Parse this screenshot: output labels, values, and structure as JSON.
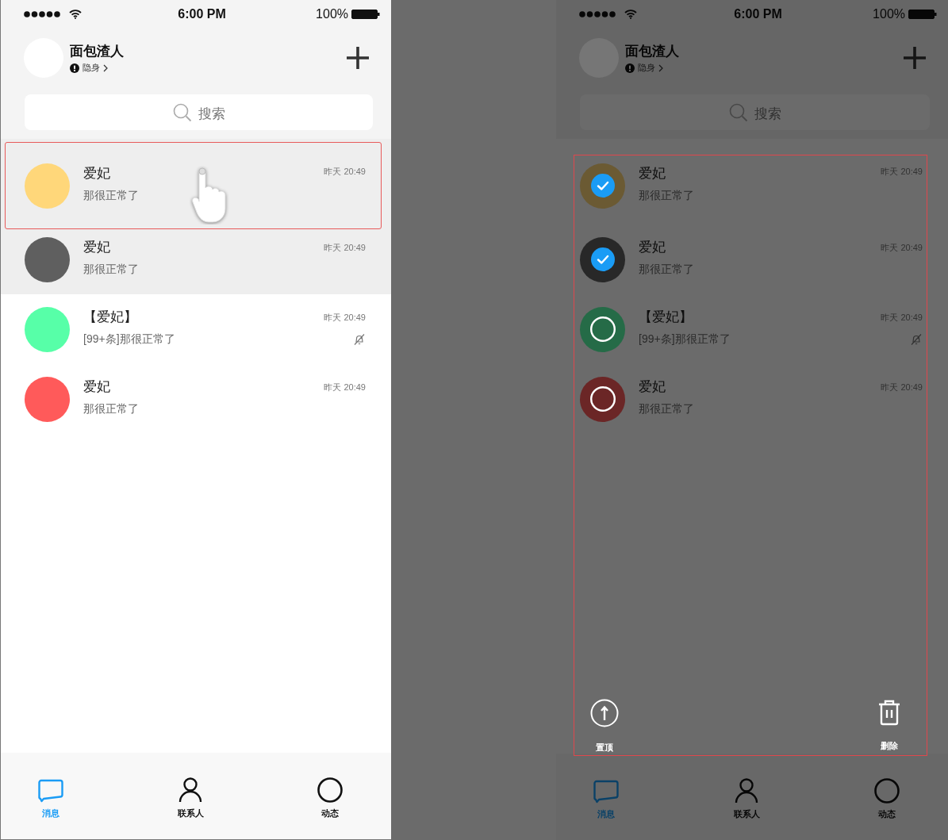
{
  "screens": [
    {
      "kind": "normal",
      "status_bar": {
        "time": "6:00 PM",
        "battery": "100%"
      },
      "profile": {
        "name": "面包渣人",
        "status": "隐身"
      },
      "search": {
        "placeholder": "搜索"
      },
      "chats": [
        {
          "name": "爱妃",
          "message": "那很正常了",
          "time": "昨天 20:49",
          "color": "#ffd77a",
          "pinned": true,
          "muted": false,
          "highlighted": true,
          "touched": true
        },
        {
          "name": "爱妃",
          "message": "那很正常了",
          "time": "昨天 20:49",
          "color": "#5f5f5f",
          "pinned": true,
          "muted": false,
          "highlighted": false,
          "touched": false
        },
        {
          "name": "【爱妃】",
          "message": "[99+条]那很正常了",
          "time": "昨天 20:49",
          "color": "#57ffa8",
          "pinned": false,
          "muted": true,
          "highlighted": false,
          "touched": false
        },
        {
          "name": "爱妃",
          "message": "那很正常了",
          "time": "昨天 20:49",
          "color": "#ff5a5a",
          "pinned": false,
          "muted": false,
          "highlighted": false,
          "touched": false
        }
      ],
      "tabs": [
        {
          "label": "消息",
          "kind": "chat",
          "selected": true
        },
        {
          "label": "联系人",
          "kind": "person",
          "selected": false
        },
        {
          "label": "动态",
          "kind": "circle",
          "selected": false
        }
      ]
    },
    {
      "kind": "select",
      "status_bar": {
        "time": "6:00 PM",
        "battery": "100%"
      },
      "profile": {
        "name": "面包渣人",
        "status": "隐身"
      },
      "search": {
        "placeholder": "搜索"
      },
      "chats": [
        {
          "name": "爱妃",
          "message": "那很正常了",
          "time": "昨天 20:49",
          "color": "#6b5a33",
          "muted": false,
          "checked": true
        },
        {
          "name": "爱妃",
          "message": "那很正常了",
          "time": "昨天 20:49",
          "color": "#282828",
          "muted": false,
          "checked": true
        },
        {
          "name": "【爱妃】",
          "message": "[99+条]那很正常了",
          "time": "昨天 20:49",
          "color": "#256b47",
          "muted": true,
          "checked": false
        },
        {
          "name": "爱妃",
          "message": "那很正常了",
          "time": "昨天 20:49",
          "color": "#6b2626",
          "muted": false,
          "checked": false
        }
      ],
      "actions": [
        {
          "label": "置顶",
          "kind": "pin"
        },
        {
          "label": "删除",
          "kind": "delete"
        }
      ],
      "tabs": [
        {
          "label": "消息",
          "kind": "chat",
          "selected": true
        },
        {
          "label": "联系人",
          "kind": "person",
          "selected": false
        },
        {
          "label": "动态",
          "kind": "circle",
          "selected": false
        }
      ]
    }
  ]
}
